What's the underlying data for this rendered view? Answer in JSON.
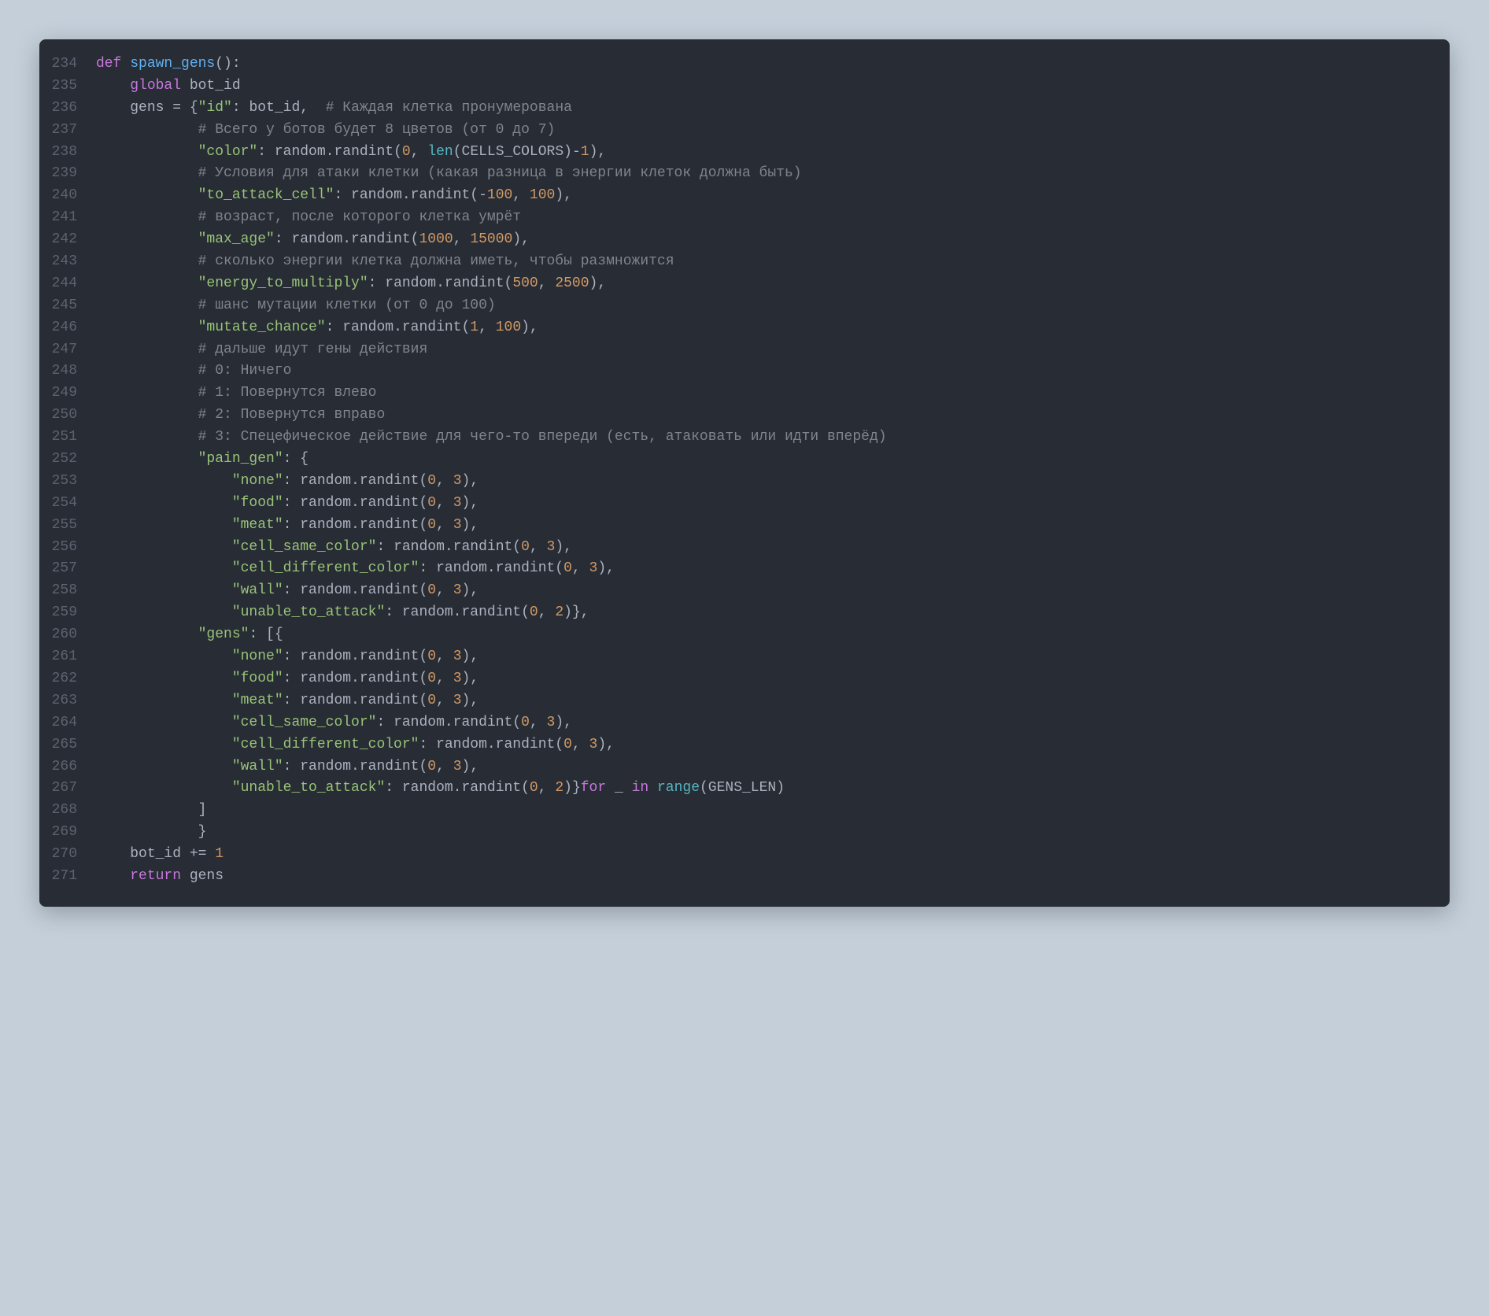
{
  "file": {
    "language": "python",
    "startLine": 234,
    "lines": [
      {
        "n": 234,
        "ind": 0,
        "tokens": [
          [
            "kw",
            "def"
          ],
          [
            "punc",
            " "
          ],
          [
            "fn",
            "spawn_gens"
          ],
          [
            "punc",
            "():"
          ]
        ]
      },
      {
        "n": 235,
        "ind": 1,
        "tokens": [
          [
            "kw",
            "global"
          ],
          [
            "punc",
            " bot_id"
          ]
        ]
      },
      {
        "n": 236,
        "ind": 1,
        "tokens": [
          [
            "punc",
            "gens = {"
          ],
          [
            "str",
            "\"id\""
          ],
          [
            "punc",
            ": bot_id,  "
          ],
          [
            "cmt",
            "# Каждая клетка пронумерована"
          ]
        ]
      },
      {
        "n": 237,
        "ind": 3,
        "tokens": [
          [
            "cmt",
            "# Всего у ботов будет 8 цветов (от 0 до 7)"
          ]
        ]
      },
      {
        "n": 238,
        "ind": 3,
        "tokens": [
          [
            "str",
            "\"color\""
          ],
          [
            "punc",
            ": random.randint("
          ],
          [
            "num",
            "0"
          ],
          [
            "punc",
            ", "
          ],
          [
            "builtin",
            "len"
          ],
          [
            "punc",
            "(CELLS_COLORS)-"
          ],
          [
            "num",
            "1"
          ],
          [
            "punc",
            "),"
          ]
        ]
      },
      {
        "n": 239,
        "ind": 3,
        "tokens": [
          [
            "cmt",
            "# Условия для атаки клетки (какая разница в энергии клеток должна быть)"
          ]
        ]
      },
      {
        "n": 240,
        "ind": 3,
        "tokens": [
          [
            "str",
            "\"to_attack_cell\""
          ],
          [
            "punc",
            ": random.randint(-"
          ],
          [
            "num",
            "100"
          ],
          [
            "punc",
            ", "
          ],
          [
            "num",
            "100"
          ],
          [
            "punc",
            "),"
          ]
        ]
      },
      {
        "n": 241,
        "ind": 3,
        "tokens": [
          [
            "cmt",
            "# возраст, после которого клетка умрёт"
          ]
        ]
      },
      {
        "n": 242,
        "ind": 3,
        "tokens": [
          [
            "str",
            "\"max_age\""
          ],
          [
            "punc",
            ": random.randint("
          ],
          [
            "num",
            "1000"
          ],
          [
            "punc",
            ", "
          ],
          [
            "num",
            "15000"
          ],
          [
            "punc",
            "),"
          ]
        ]
      },
      {
        "n": 243,
        "ind": 3,
        "tokens": [
          [
            "cmt",
            "# сколько энергии клетка должна иметь, чтобы размножится"
          ]
        ]
      },
      {
        "n": 244,
        "ind": 3,
        "tokens": [
          [
            "str",
            "\"energy_to_multiply\""
          ],
          [
            "punc",
            ": random.randint("
          ],
          [
            "num",
            "500"
          ],
          [
            "punc",
            ", "
          ],
          [
            "num",
            "2500"
          ],
          [
            "punc",
            "),"
          ]
        ]
      },
      {
        "n": 245,
        "ind": 3,
        "tokens": [
          [
            "cmt",
            "# шанс мутации клетки (от 0 до 100)"
          ]
        ]
      },
      {
        "n": 246,
        "ind": 3,
        "tokens": [
          [
            "str",
            "\"mutate_chance\""
          ],
          [
            "punc",
            ": random.randint("
          ],
          [
            "num",
            "1"
          ],
          [
            "punc",
            ", "
          ],
          [
            "num",
            "100"
          ],
          [
            "punc",
            "),"
          ]
        ]
      },
      {
        "n": 247,
        "ind": 3,
        "tokens": [
          [
            "cmt",
            "# дальше идут гены действия"
          ]
        ]
      },
      {
        "n": 248,
        "ind": 3,
        "tokens": [
          [
            "cmt",
            "# 0: Ничего"
          ]
        ]
      },
      {
        "n": 249,
        "ind": 3,
        "tokens": [
          [
            "cmt",
            "# 1: Повернутся влево"
          ]
        ]
      },
      {
        "n": 250,
        "ind": 3,
        "tokens": [
          [
            "cmt",
            "# 2: Повернутся вправо"
          ]
        ]
      },
      {
        "n": 251,
        "ind": 3,
        "tokens": [
          [
            "cmt",
            "# 3: Спецефическое действие для чего-то впереди (есть, атаковать или идти вперёд)"
          ]
        ]
      },
      {
        "n": 252,
        "ind": 3,
        "tokens": [
          [
            "str",
            "\"pain_gen\""
          ],
          [
            "punc",
            ": {"
          ]
        ]
      },
      {
        "n": 253,
        "ind": 4,
        "tokens": [
          [
            "str",
            "\"none\""
          ],
          [
            "punc",
            ": random.randint("
          ],
          [
            "num",
            "0"
          ],
          [
            "punc",
            ", "
          ],
          [
            "num",
            "3"
          ],
          [
            "punc",
            "),"
          ]
        ]
      },
      {
        "n": 254,
        "ind": 4,
        "tokens": [
          [
            "str",
            "\"food\""
          ],
          [
            "punc",
            ": random.randint("
          ],
          [
            "num",
            "0"
          ],
          [
            "punc",
            ", "
          ],
          [
            "num",
            "3"
          ],
          [
            "punc",
            "),"
          ]
        ]
      },
      {
        "n": 255,
        "ind": 4,
        "tokens": [
          [
            "str",
            "\"meat\""
          ],
          [
            "punc",
            ": random.randint("
          ],
          [
            "num",
            "0"
          ],
          [
            "punc",
            ", "
          ],
          [
            "num",
            "3"
          ],
          [
            "punc",
            "),"
          ]
        ]
      },
      {
        "n": 256,
        "ind": 4,
        "tokens": [
          [
            "str",
            "\"cell_same_color\""
          ],
          [
            "punc",
            ": random.randint("
          ],
          [
            "num",
            "0"
          ],
          [
            "punc",
            ", "
          ],
          [
            "num",
            "3"
          ],
          [
            "punc",
            "),"
          ]
        ]
      },
      {
        "n": 257,
        "ind": 4,
        "tokens": [
          [
            "str",
            "\"cell_different_color\""
          ],
          [
            "punc",
            ": random.randint("
          ],
          [
            "num",
            "0"
          ],
          [
            "punc",
            ", "
          ],
          [
            "num",
            "3"
          ],
          [
            "punc",
            "),"
          ]
        ]
      },
      {
        "n": 258,
        "ind": 4,
        "tokens": [
          [
            "str",
            "\"wall\""
          ],
          [
            "punc",
            ": random.randint("
          ],
          [
            "num",
            "0"
          ],
          [
            "punc",
            ", "
          ],
          [
            "num",
            "3"
          ],
          [
            "punc",
            "),"
          ]
        ]
      },
      {
        "n": 259,
        "ind": 4,
        "tokens": [
          [
            "str",
            "\"unable_to_attack\""
          ],
          [
            "punc",
            ": random.randint("
          ],
          [
            "num",
            "0"
          ],
          [
            "punc",
            ", "
          ],
          [
            "num",
            "2"
          ],
          [
            "punc",
            ")},"
          ]
        ]
      },
      {
        "n": 260,
        "ind": 3,
        "tokens": [
          [
            "str",
            "\"gens\""
          ],
          [
            "punc",
            ": [{"
          ]
        ]
      },
      {
        "n": 261,
        "ind": 4,
        "tokens": [
          [
            "str",
            "\"none\""
          ],
          [
            "punc",
            ": random.randint("
          ],
          [
            "num",
            "0"
          ],
          [
            "punc",
            ", "
          ],
          [
            "num",
            "3"
          ],
          [
            "punc",
            "),"
          ]
        ]
      },
      {
        "n": 262,
        "ind": 4,
        "tokens": [
          [
            "str",
            "\"food\""
          ],
          [
            "punc",
            ": random.randint("
          ],
          [
            "num",
            "0"
          ],
          [
            "punc",
            ", "
          ],
          [
            "num",
            "3"
          ],
          [
            "punc",
            "),"
          ]
        ]
      },
      {
        "n": 263,
        "ind": 4,
        "tokens": [
          [
            "str",
            "\"meat\""
          ],
          [
            "punc",
            ": random.randint("
          ],
          [
            "num",
            "0"
          ],
          [
            "punc",
            ", "
          ],
          [
            "num",
            "3"
          ],
          [
            "punc",
            "),"
          ]
        ]
      },
      {
        "n": 264,
        "ind": 4,
        "tokens": [
          [
            "str",
            "\"cell_same_color\""
          ],
          [
            "punc",
            ": random.randint("
          ],
          [
            "num",
            "0"
          ],
          [
            "punc",
            ", "
          ],
          [
            "num",
            "3"
          ],
          [
            "punc",
            "),"
          ]
        ]
      },
      {
        "n": 265,
        "ind": 4,
        "tokens": [
          [
            "str",
            "\"cell_different_color\""
          ],
          [
            "punc",
            ": random.randint("
          ],
          [
            "num",
            "0"
          ],
          [
            "punc",
            ", "
          ],
          [
            "num",
            "3"
          ],
          [
            "punc",
            "),"
          ]
        ]
      },
      {
        "n": 266,
        "ind": 4,
        "tokens": [
          [
            "str",
            "\"wall\""
          ],
          [
            "punc",
            ": random.randint("
          ],
          [
            "num",
            "0"
          ],
          [
            "punc",
            ", "
          ],
          [
            "num",
            "3"
          ],
          [
            "punc",
            "),"
          ]
        ]
      },
      {
        "n": 267,
        "ind": 4,
        "tokens": [
          [
            "str",
            "\"unable_to_attack\""
          ],
          [
            "punc",
            ": random.randint("
          ],
          [
            "num",
            "0"
          ],
          [
            "punc",
            ", "
          ],
          [
            "num",
            "2"
          ],
          [
            "punc",
            ")}"
          ],
          [
            "kw",
            "for"
          ],
          [
            "punc",
            " _ "
          ],
          [
            "kw",
            "in"
          ],
          [
            "punc",
            " "
          ],
          [
            "builtin",
            "range"
          ],
          [
            "punc",
            "(GENS_LEN)"
          ]
        ]
      },
      {
        "n": 268,
        "ind": 3,
        "tokens": [
          [
            "punc",
            "]"
          ]
        ]
      },
      {
        "n": 269,
        "ind": 3,
        "tokens": [
          [
            "punc",
            "}"
          ]
        ]
      },
      {
        "n": 270,
        "ind": 1,
        "tokens": [
          [
            "punc",
            "bot_id += "
          ],
          [
            "num",
            "1"
          ]
        ]
      },
      {
        "n": 271,
        "ind": 1,
        "tokens": [
          [
            "kw",
            "return"
          ],
          [
            "punc",
            " gens"
          ]
        ]
      }
    ]
  },
  "indentUnit": "    "
}
